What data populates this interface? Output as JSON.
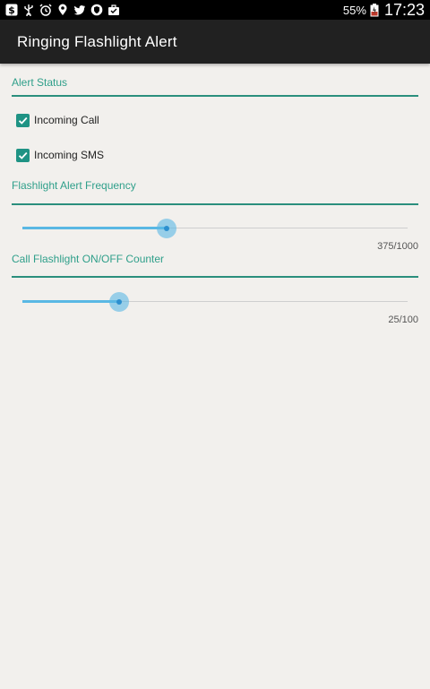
{
  "status_bar": {
    "icons": [
      "dollar-icon",
      "usb-icon",
      "alarm-icon",
      "location-icon",
      "twitter-icon",
      "shield-icon",
      "briefcase-icon"
    ],
    "battery_percent": "55%",
    "time": "17:23"
  },
  "app": {
    "title": "Ringing Flashlight Alert"
  },
  "alert_status": {
    "header": "Alert Status",
    "options": [
      {
        "label": "Incoming Call",
        "checked": true
      },
      {
        "label": "Incoming SMS",
        "checked": true
      }
    ]
  },
  "frequency": {
    "header": "Flashlight Alert Frequency",
    "value": 375,
    "max": 1000,
    "value_text": "375/1000"
  },
  "counter": {
    "header": "Call Flashlight ON/OFF Counter",
    "value": 25,
    "max": 100,
    "value_text": "25/100"
  },
  "colors": {
    "accent": "#1f9384",
    "slider": "#5ab8e4",
    "action_bar": "#212121",
    "background": "#f2f0ed"
  }
}
